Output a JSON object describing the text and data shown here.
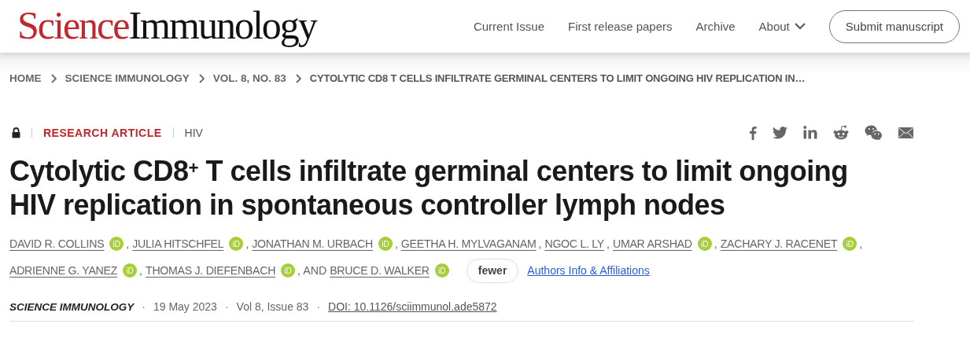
{
  "header": {
    "logo": {
      "brand": "Science",
      "journal": "Immunology"
    },
    "nav": [
      {
        "label": "Current Issue",
        "kind": "link"
      },
      {
        "label": "First release papers",
        "kind": "link"
      },
      {
        "label": "Archive",
        "kind": "link"
      },
      {
        "label": "About",
        "kind": "dropdown"
      }
    ],
    "submit_button": "Submit manuscript"
  },
  "breadcrumb": [
    "HOME",
    "SCIENCE IMMUNOLOGY",
    "VOL. 8, NO. 83",
    "CYTOLYTIC CD8 T CELLS INFILTRATE GERMINAL CENTERS TO LIMIT ONGOING HIV REPLICATION IN…"
  ],
  "article": {
    "locked": true,
    "type": "RESEARCH ARTICLE",
    "topic": "HIV",
    "share": [
      {
        "kind": "facebook"
      },
      {
        "kind": "twitter"
      },
      {
        "kind": "linkedin"
      },
      {
        "kind": "reddit"
      },
      {
        "kind": "wechat"
      },
      {
        "kind": "email"
      }
    ],
    "title": "Cytolytic CD8$^{+}$ T cells infiltrate germinal centers to limit ongoing HIV replication in spontaneous controller lymph nodes",
    "author_lines": [
      [
        {
          "name": "DAVID R. COLLINS",
          "orcid": "iD",
          "separator": ","
        },
        {
          "name": "JULIA HITSCHFEL",
          "orcid": "iD",
          "separator": ","
        },
        {
          "name": "JONATHAN M. URBACH",
          "orcid": "iD",
          "separator": ","
        },
        {
          "name": "GEETHA H. MYLVAGANAM",
          "separator": ","
        },
        {
          "name": "NGOC L. LY",
          "separator": ","
        },
        {
          "name": "UMAR ARSHAD",
          "orcid": "iD",
          "separator": ","
        },
        {
          "name": "ZACHARY J. RACENET",
          "orcid": "iD",
          "separator": ","
        }
      ],
      [
        {
          "name": "ADRIENNE G. YANEZ",
          "orcid": "iD",
          "separator": ","
        },
        {
          "name": "THOMAS J. DIEFENBACH",
          "orcid": "iD",
          "separator": ", AND"
        },
        {
          "name": "BRUCE D. WALKER",
          "orcid": "iD"
        }
      ]
    ],
    "fewer_button": "fewer",
    "affiliations_link": "Authors Info & Affiliations",
    "meta": [
      {
        "kind": "journal",
        "text": "SCIENCE IMMUNOLOGY"
      },
      {
        "kind": "separator",
        "text": "·"
      },
      {
        "kind": "date",
        "text": "19 May 2023"
      },
      {
        "kind": "separator",
        "text": "·"
      },
      {
        "kind": "issue",
        "text": "Vol 8, Issue 83"
      },
      {
        "kind": "separator",
        "text": "·"
      },
      {
        "kind": "doi",
        "text": "DOI: 10.1126/sciimmunol.ade5872"
      }
    ]
  }
}
